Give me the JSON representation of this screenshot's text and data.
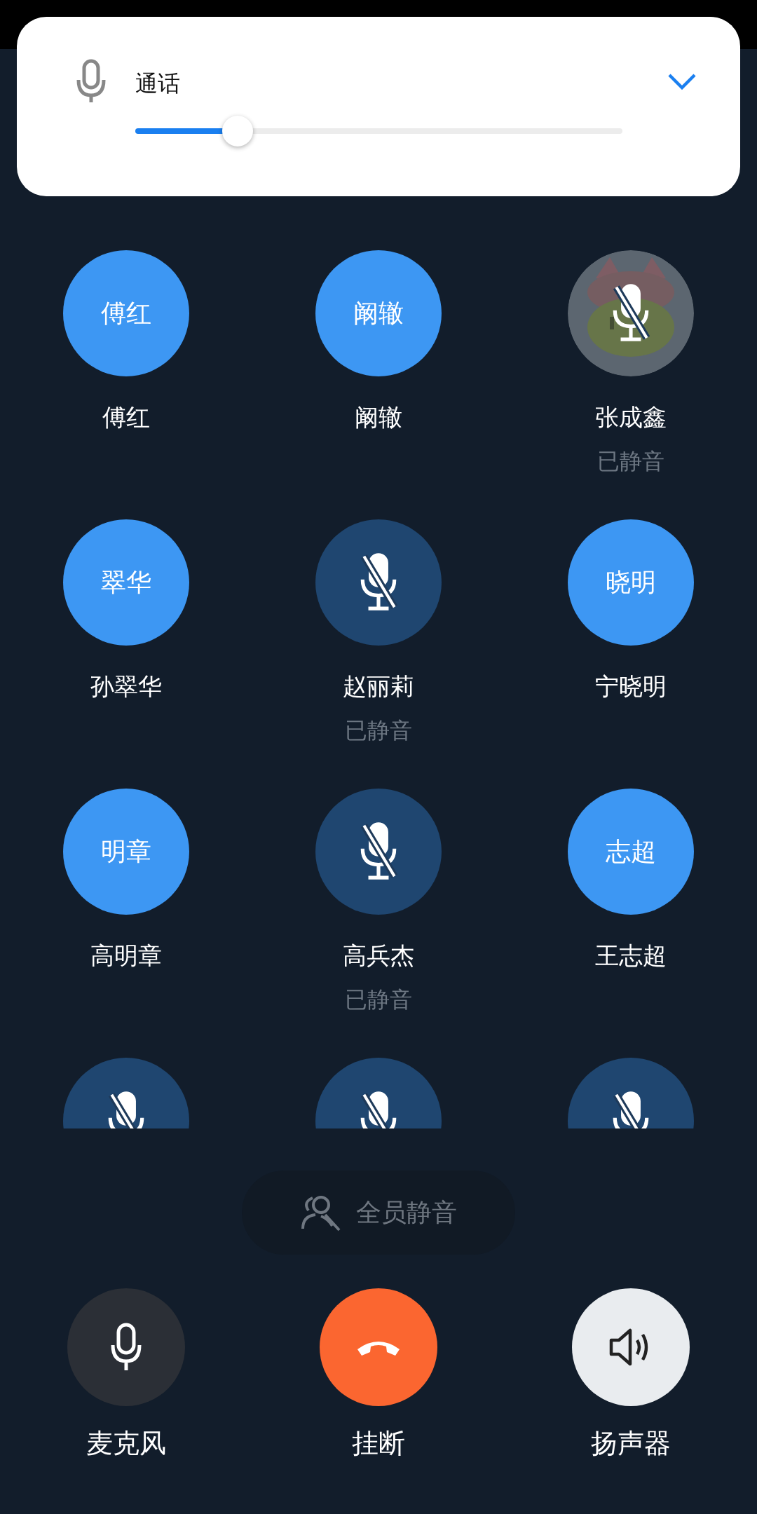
{
  "volume_panel": {
    "title": "通话",
    "level": 0.21
  },
  "participants": [
    {
      "kind": "initials",
      "avatar_text": "傅红",
      "name": "傅红",
      "muted": false
    },
    {
      "kind": "initials",
      "avatar_text": "阚辙",
      "name": "阚辙",
      "muted": false
    },
    {
      "kind": "picture",
      "name": "张成鑫",
      "muted": true,
      "status": "已静音"
    },
    {
      "kind": "initials",
      "avatar_text": "翠华",
      "name": "孙翠华",
      "muted": false
    },
    {
      "kind": "initials",
      "name": "赵丽莉",
      "muted": true,
      "status": "已静音"
    },
    {
      "kind": "initials",
      "avatar_text": "晓明",
      "name": "宁晓明",
      "muted": false
    },
    {
      "kind": "initials",
      "avatar_text": "明章",
      "name": "高明章",
      "muted": false
    },
    {
      "kind": "initials",
      "name": "高兵杰",
      "muted": true,
      "status": "已静音"
    },
    {
      "kind": "initials",
      "avatar_text": "志超",
      "name": "王志超",
      "muted": false
    },
    {
      "kind": "initials",
      "muted": true
    },
    {
      "kind": "initials",
      "muted": true
    },
    {
      "kind": "initials",
      "muted": true
    }
  ],
  "mute_all_button": {
    "label": "全员静音",
    "disabled": true
  },
  "controls": [
    {
      "kind": "microphone",
      "label": "麦克风"
    },
    {
      "kind": "hangup",
      "label": "挂断"
    },
    {
      "kind": "speaker",
      "label": "扬声器"
    }
  ]
}
